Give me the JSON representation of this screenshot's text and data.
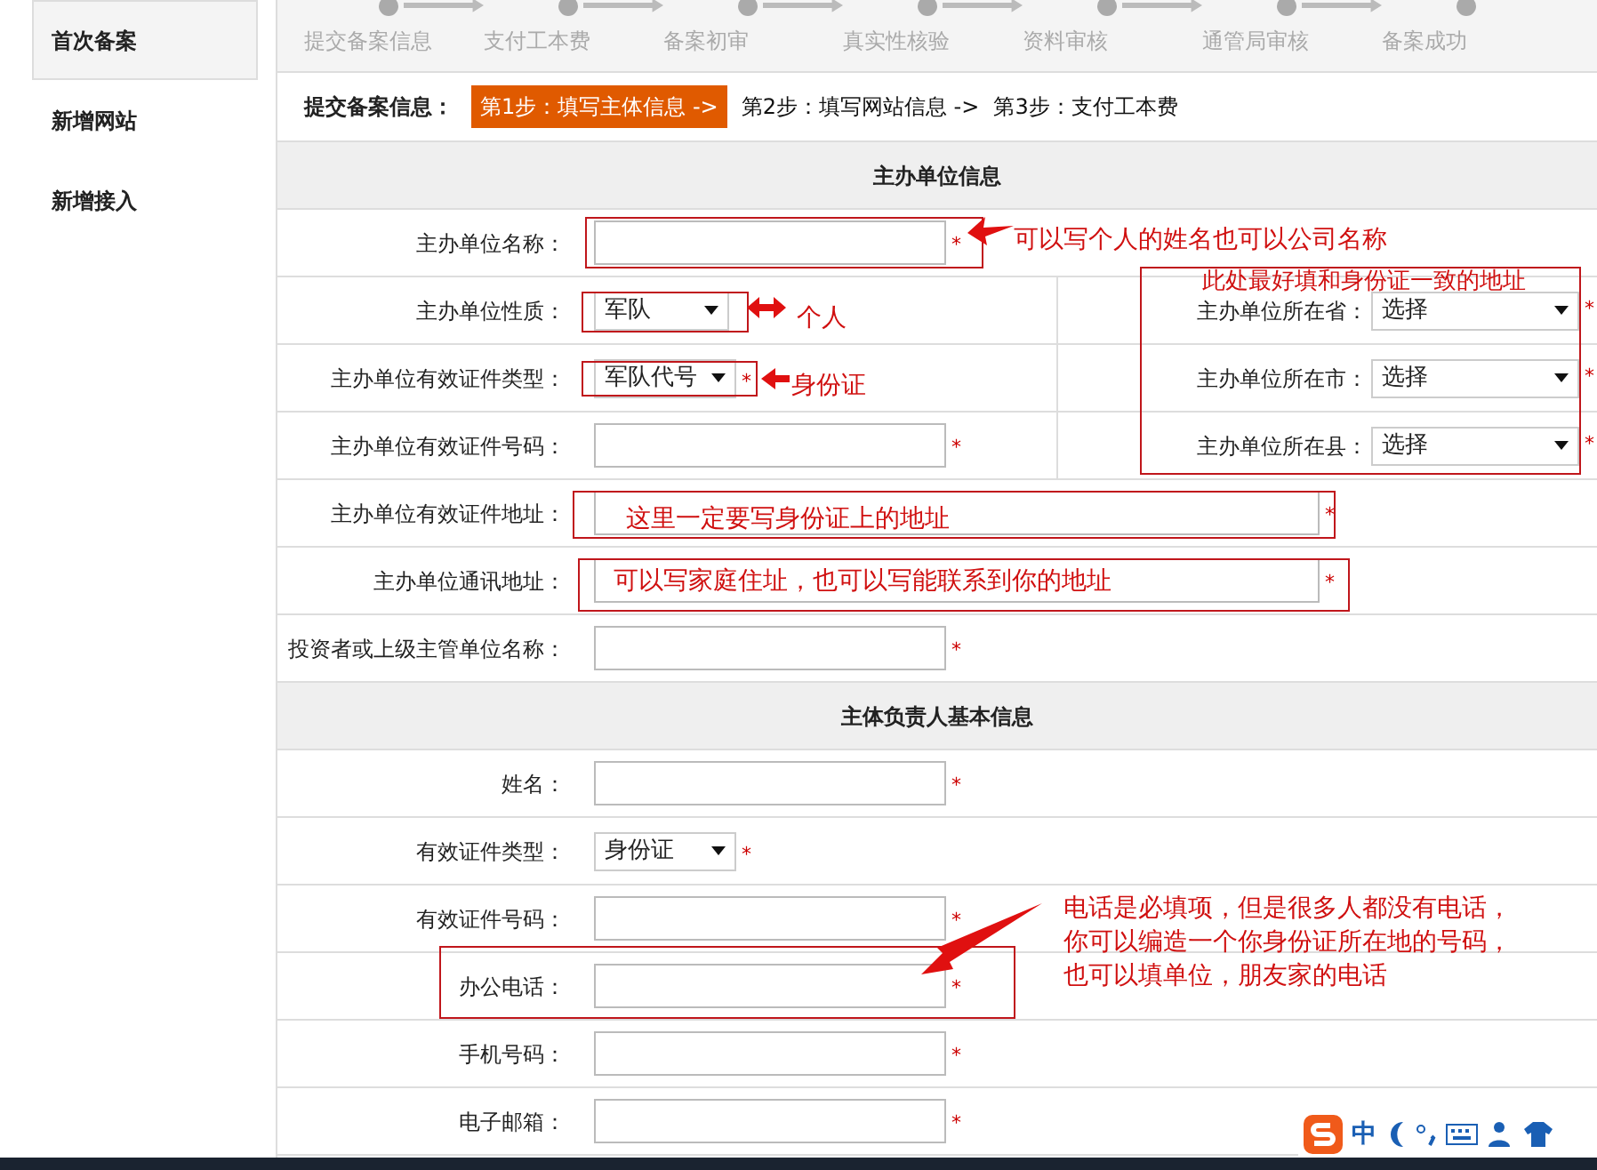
{
  "sidebar": {
    "items": [
      {
        "label": "首次备案",
        "selected": true
      },
      {
        "label": "新增网站",
        "selected": false
      },
      {
        "label": "新增接入",
        "selected": false
      }
    ]
  },
  "progress": {
    "steps": [
      {
        "label": "提交备案信息"
      },
      {
        "label": "支付工本费"
      },
      {
        "label": "备案初审"
      },
      {
        "label": "真实性核验"
      },
      {
        "label": "资料审核"
      },
      {
        "label": "通管局审核"
      },
      {
        "label": "备案成功"
      }
    ]
  },
  "step_bar": {
    "label": "提交备案信息：",
    "steps": [
      {
        "label": "第1步：填写主体信息 ->",
        "selected": true
      },
      {
        "label": "第2步：填写网站信息 ->",
        "selected": false
      },
      {
        "label": "第3步：支付工本费",
        "selected": false
      }
    ]
  },
  "sections": [
    {
      "title": "主办单位信息",
      "rows": [
        {
          "label": "主办单位名称：",
          "kind": "input",
          "mark": "*"
        },
        {
          "label": "主办单位性质：",
          "kind": "select",
          "value": "军队",
          "right": {
            "label": "主办单位所在省：",
            "kind": "select",
            "value": "选择",
            "mark": "*"
          }
        },
        {
          "label": "主办单位有效证件类型：",
          "kind": "select",
          "value": "军队代号",
          "mark": "*",
          "right": {
            "label": "主办单位所在市：",
            "kind": "select",
            "value": "选择",
            "mark": "*"
          }
        },
        {
          "label": "主办单位有效证件号码：",
          "kind": "input",
          "mark": "*",
          "right": {
            "label": "主办单位所在县：",
            "kind": "select",
            "value": "选择",
            "mark": "*"
          }
        },
        {
          "label": "主办单位有效证件地址：",
          "kind": "wide",
          "mark": "*"
        },
        {
          "label": "主办单位通讯地址：",
          "kind": "wide",
          "mark": "*"
        },
        {
          "label": "投资者或上级主管单位名称：",
          "kind": "input",
          "mark": "*"
        }
      ]
    },
    {
      "title": "主体负责人基本信息",
      "rows": [
        {
          "label": "姓名：",
          "kind": "input",
          "mark": "*"
        },
        {
          "label": "有效证件类型：",
          "kind": "select",
          "value": "身份证",
          "mark": "*"
        },
        {
          "label": "有效证件号码：",
          "kind": "input",
          "mark": "*"
        },
        {
          "label": "办公电话：",
          "kind": "input",
          "mark": "*"
        },
        {
          "label": "手机号码：",
          "kind": "input",
          "mark": "*"
        },
        {
          "label": "电子邮箱：",
          "kind": "input",
          "mark": "*"
        }
      ]
    }
  ],
  "annotations": [
    {
      "text": "可以写个人的姓名也可以公司名称"
    },
    {
      "text": "个人"
    },
    {
      "text": "身份证"
    },
    {
      "text": "此处最好填和身份证一致的地址"
    },
    {
      "text": "这里一定要写身份证上的地址"
    },
    {
      "text": "可以写家庭住址，也可以写能联系到你的地址"
    },
    {
      "text": "电话是必填项，但是很多人都没有电话，你可以编造一个你身份证所在地的号码，也可以填单位，朋友家的电话"
    }
  ],
  "ime_toolbar": {
    "mode": "中"
  }
}
